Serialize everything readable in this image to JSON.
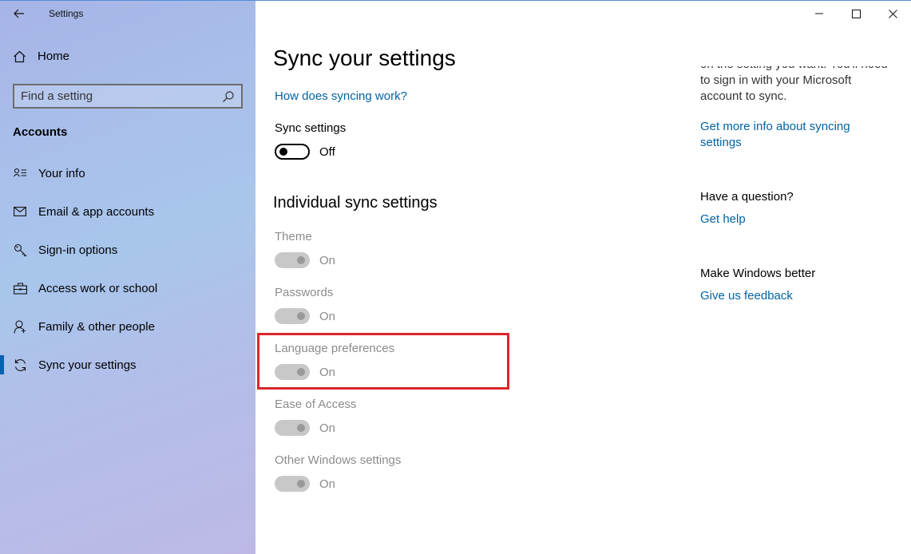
{
  "app": {
    "title": "Settings"
  },
  "sidebar": {
    "home": "Home",
    "search_placeholder": "Find a setting",
    "section": "Accounts",
    "items": [
      {
        "label": "Your info",
        "icon": "person-card-icon"
      },
      {
        "label": "Email & app accounts",
        "icon": "mail-icon"
      },
      {
        "label": "Sign-in options",
        "icon": "key-icon"
      },
      {
        "label": "Access work or school",
        "icon": "briefcase-icon"
      },
      {
        "label": "Family & other people",
        "icon": "person-add-icon"
      },
      {
        "label": "Sync your settings",
        "icon": "sync-icon",
        "active": true
      }
    ]
  },
  "main": {
    "title": "Sync your settings",
    "how_link": "How does syncing work?",
    "sync_settings": {
      "label": "Sync settings",
      "state": "Off"
    },
    "individual_title": "Individual sync settings",
    "individual": [
      {
        "label": "Theme",
        "state": "On"
      },
      {
        "label": "Passwords",
        "state": "On"
      },
      {
        "label": "Language preferences",
        "state": "On"
      },
      {
        "label": "Ease of Access",
        "state": "On"
      },
      {
        "label": "Other Windows settings",
        "state": "On"
      }
    ]
  },
  "right": {
    "cut_line": "on the setting you want. You'll need",
    "text_line2": "to sign in with your Microsoft",
    "text_line3": "account to sync.",
    "more_info_link_line1": "Get more info about syncing",
    "more_info_link_line2": "settings",
    "question_title": "Have a question?",
    "get_help": "Get help",
    "better_title": "Make Windows better",
    "feedback": "Give us feedback"
  },
  "colors": {
    "accent": "#0063b1",
    "link": "#0063a5",
    "highlight_box": "#d9262c"
  }
}
